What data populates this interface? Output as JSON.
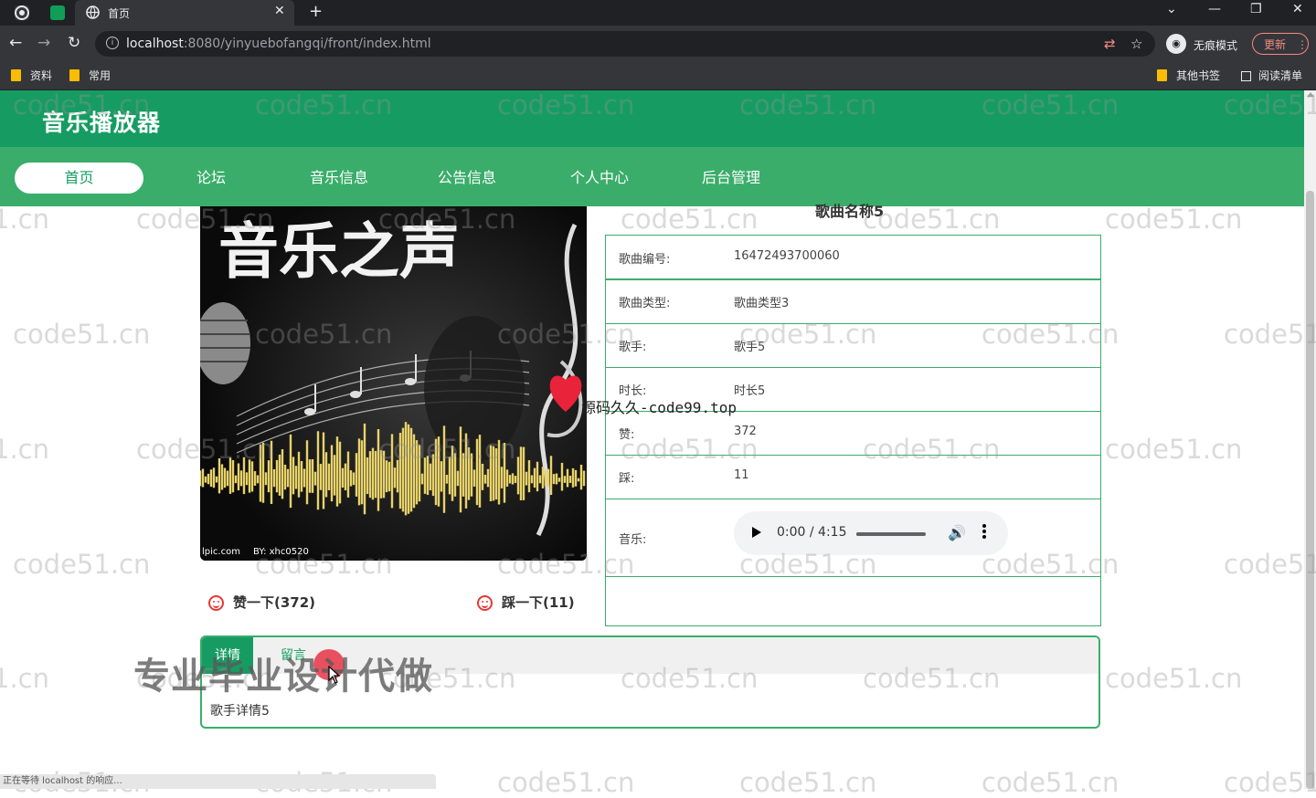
{
  "browser": {
    "tab_title": "首页",
    "url_host": "localhost",
    "url_path": ":8080/yinyuebofangqi/front/index.html",
    "profile_label": "无痕模式",
    "update_label": "更新",
    "bookmarks": [
      "资料",
      "常用"
    ],
    "bookmarks_right": [
      "其他书签",
      "阅读清单"
    ]
  },
  "site": {
    "title": "音乐播放器",
    "nav": [
      "首页",
      "论坛",
      "音乐信息",
      "公告信息",
      "个人中心",
      "后台管理"
    ],
    "active_nav": "首页"
  },
  "album_art": {
    "title_text": "音乐之声",
    "caption_left": "lpic.com",
    "caption_right": "BY: xhc0520"
  },
  "song": {
    "name": "歌曲名称5",
    "fields": [
      {
        "label": "歌曲编号:",
        "value": "16472493700060"
      },
      {
        "label": "歌曲类型:",
        "value": "歌曲类型3"
      },
      {
        "label": "歌手:",
        "value": "歌手5"
      },
      {
        "label": "时长:",
        "value": "时长5"
      },
      {
        "label": "赞:",
        "value": "372"
      },
      {
        "label": "踩:",
        "value": "11"
      }
    ],
    "music_label": "音乐:",
    "audio": {
      "time": "0:00 / 4:15",
      "volume_level": 0.85
    }
  },
  "actions": {
    "like": "赞一下(372)",
    "dislike": "踩一下(11)"
  },
  "detail": {
    "tabs": [
      "详情",
      "留言"
    ],
    "content": "歌手详情5"
  },
  "overlays": {
    "watermark": "code51.cn",
    "code99": "源码久久-code99.top",
    "ad_text": "专业毕业设计代做"
  },
  "status_text": "正在等待 localhost 的响应...",
  "colors": {
    "header": "#169c62",
    "nav": "#3aad6a",
    "border": "#3aad6a",
    "like_icon": "#e53935"
  }
}
